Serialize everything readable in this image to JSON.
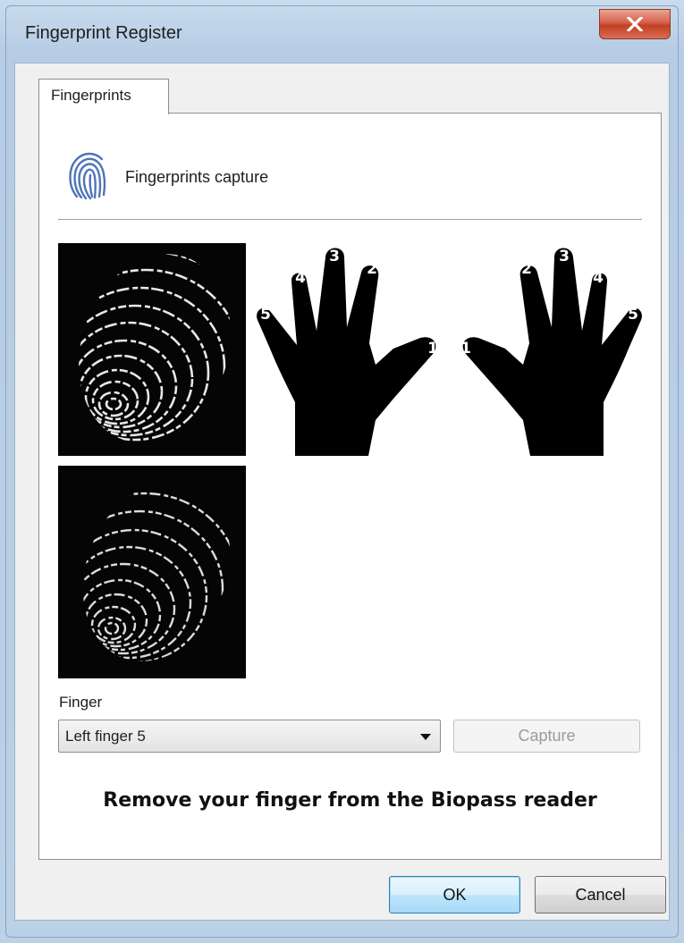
{
  "window": {
    "title": "Fingerprint Register",
    "close_icon": "close-icon"
  },
  "tabs": [
    {
      "label": "Fingerprints",
      "selected": true
    }
  ],
  "section": {
    "icon": "fingerprint-icon",
    "heading": "Fingerprints capture"
  },
  "hands": {
    "left_labels": [
      "5",
      "4",
      "3",
      "2",
      "1"
    ],
    "right_labels": [
      "1",
      "2",
      "3",
      "4",
      "5"
    ]
  },
  "finger": {
    "label": "Finger",
    "selected": "Left finger 5"
  },
  "capture_button": {
    "label": "Capture",
    "enabled": false
  },
  "status": "Remove your finger from the Biopass reader",
  "buttons": {
    "ok": "OK",
    "cancel": "Cancel"
  },
  "colors": {
    "accent": "#3c7fb1",
    "close_red": "#c23f22",
    "fingerprint_icon_blue": "#4f74b8"
  }
}
